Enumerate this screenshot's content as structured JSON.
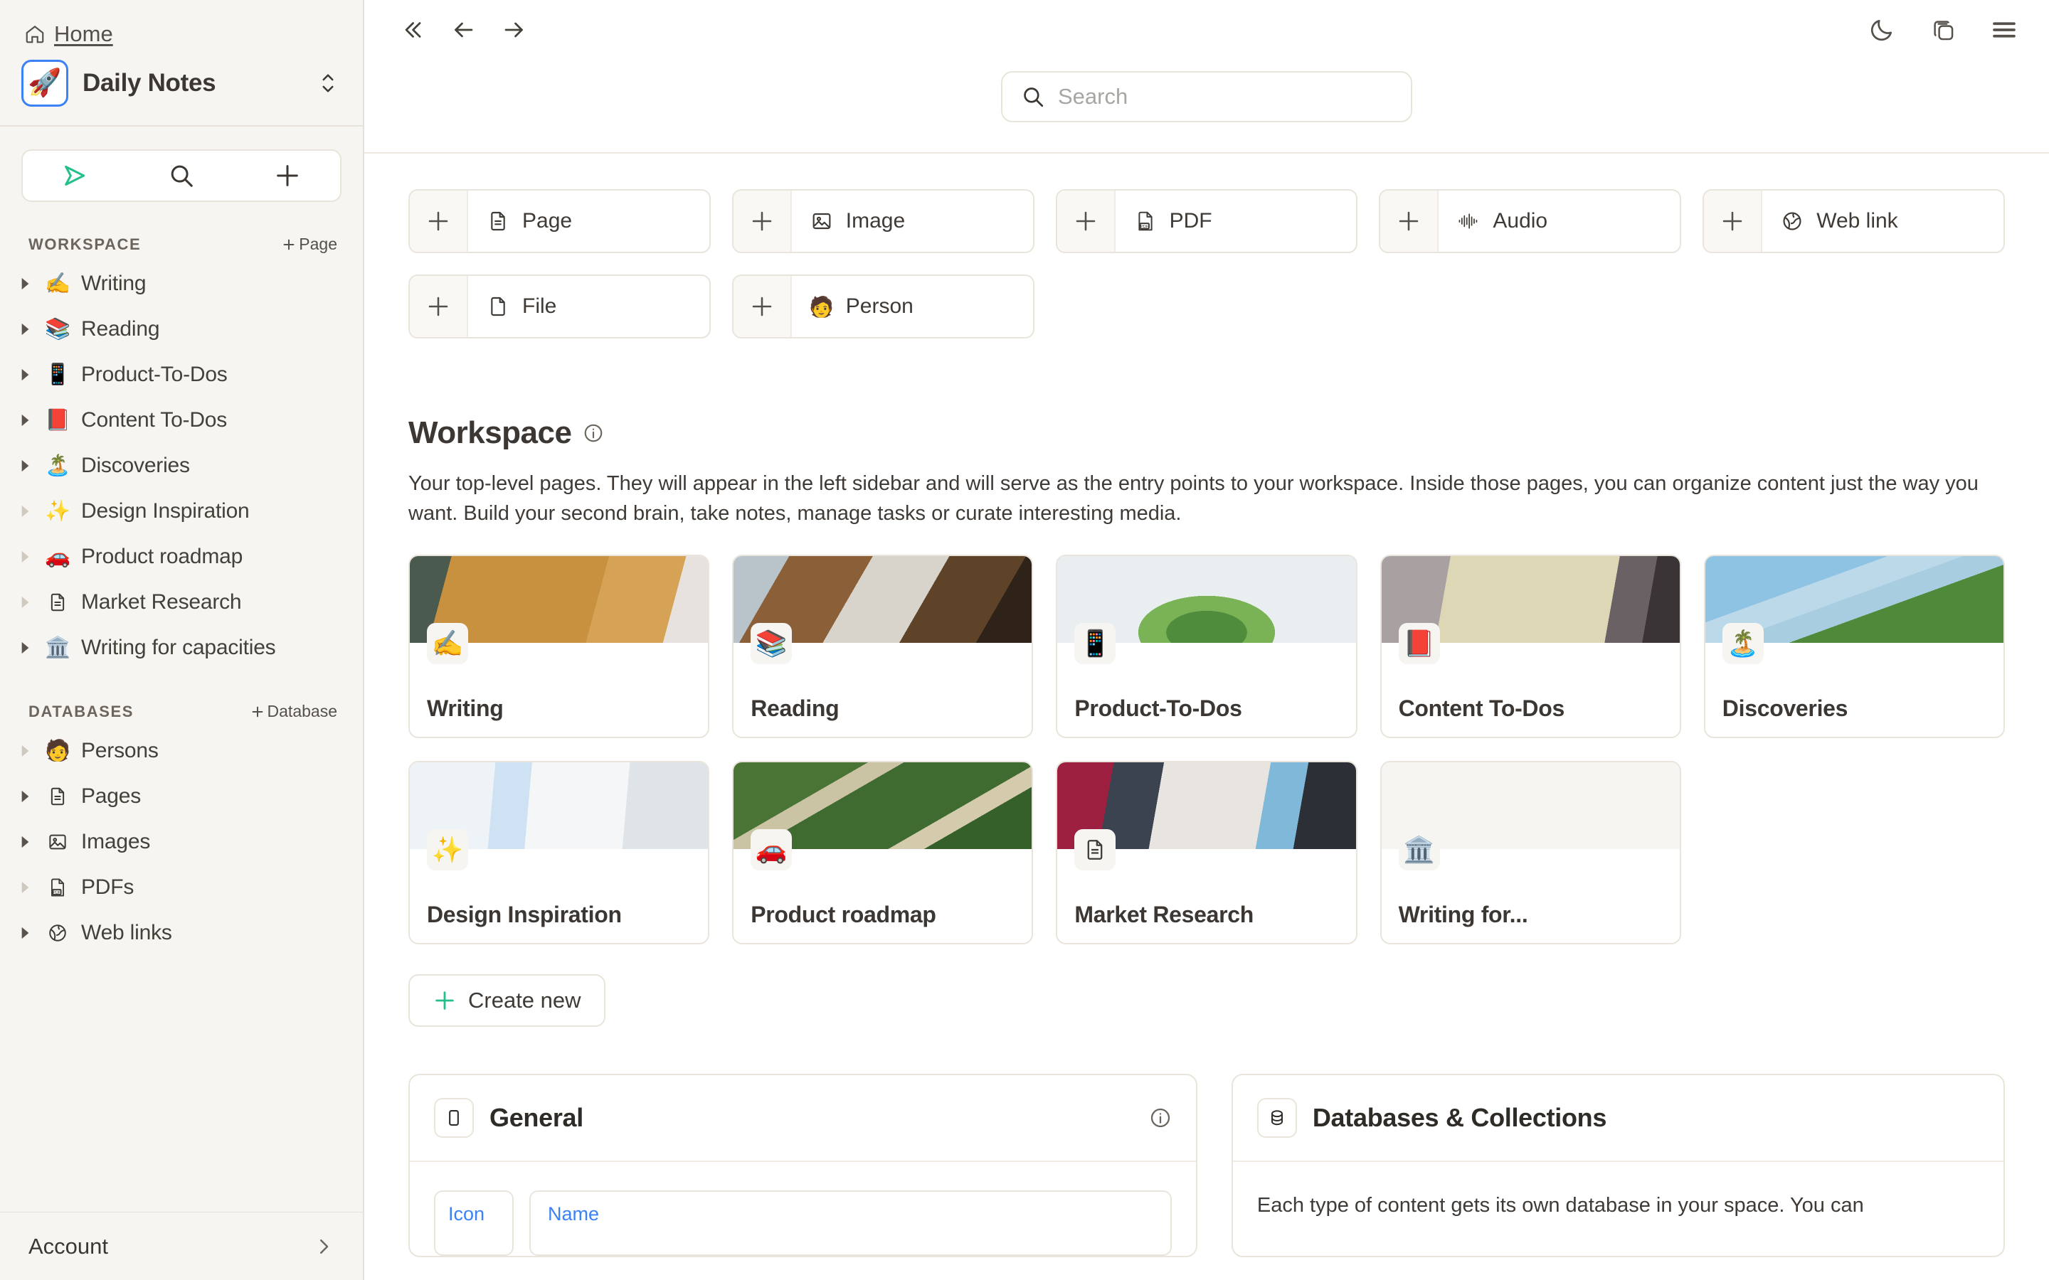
{
  "sidebar": {
    "home_label": "Home",
    "space_name": "Daily Notes",
    "space_emoji": "🚀",
    "action_bar": {
      "send_icon": "send-icon",
      "search_icon": "search-icon",
      "plus_icon": "plus-icon"
    },
    "workspace_section": {
      "label": "WORKSPACE",
      "add_label": "Page",
      "items": [
        {
          "emoji": "✍️",
          "label": "Writing",
          "caret": "dark"
        },
        {
          "emoji": "📚",
          "label": "Reading",
          "caret": "dark"
        },
        {
          "emoji": "📱",
          "label": "Product-To-Dos",
          "caret": "dark"
        },
        {
          "emoji": "📕",
          "label": "Content To-Dos",
          "caret": "dark"
        },
        {
          "emoji": "🏝️",
          "label": "Discoveries",
          "caret": "dark"
        },
        {
          "emoji": "✨",
          "label": "Design Inspiration",
          "caret": "light"
        },
        {
          "emoji": "🚗",
          "label": "Product roadmap",
          "caret": "light"
        },
        {
          "emoji": "doc-icon",
          "label": "Market Research",
          "caret": "light"
        },
        {
          "emoji": "🏛️",
          "label": "Writing for capacities",
          "caret": "dark"
        }
      ]
    },
    "databases_section": {
      "label": "DATABASES",
      "add_label": "Database",
      "items": [
        {
          "emoji": "🧑",
          "label": "Persons",
          "caret": "light"
        },
        {
          "emoji": "doc-icon",
          "label": "Pages",
          "caret": "dark"
        },
        {
          "emoji": "image-icon",
          "label": "Images",
          "caret": "dark"
        },
        {
          "emoji": "pdf-icon",
          "label": "PDFs",
          "caret": "light"
        },
        {
          "emoji": "globe-icon",
          "label": "Web links",
          "caret": "dark"
        }
      ]
    },
    "account_label": "Account"
  },
  "topbar": {
    "collapse_icon": "collapse-sidebar-icon",
    "back_icon": "arrow-left-icon",
    "forward_icon": "arrow-right-icon",
    "dark_mode_icon": "moon-icon",
    "layers_icon": "layers-icon",
    "menu_icon": "hamburger-menu-icon"
  },
  "search": {
    "placeholder": "Search",
    "value": "",
    "icon": "search-icon"
  },
  "quick_add": {
    "items": [
      {
        "label": "Page",
        "icon": "page-icon"
      },
      {
        "label": "Image",
        "icon": "image-icon"
      },
      {
        "label": "PDF",
        "icon": "pdf-icon"
      },
      {
        "label": "Audio",
        "icon": "audio-waveform-icon"
      },
      {
        "label": "Web link",
        "icon": "globe-icon"
      },
      {
        "label": "File",
        "icon": "file-icon"
      },
      {
        "label": "Person",
        "icon": "🧑"
      }
    ]
  },
  "workspace": {
    "title": "Workspace",
    "info_icon": "info-icon",
    "description": "Your top-level pages. They will appear in the left sidebar and will serve as the entry points to your workspace. Inside those pages, you can organize content just the way you want. Build your second brain, take notes, manage tasks or curate interesting media.",
    "cards": [
      {
        "name": "Writing",
        "emoji": "✍️",
        "thumb": "person-in-tan-sweater-writing"
      },
      {
        "name": "Reading",
        "emoji": "📚",
        "thumb": "hands-holding-open-book-on-wood-desk"
      },
      {
        "name": "Product-To-Dos",
        "emoji": "📱",
        "thumb": "green-succulent-plant-on-white"
      },
      {
        "name": "Content To-Dos",
        "emoji": "📕",
        "thumb": "sticky-notes-on-wall"
      },
      {
        "name": "Discoveries",
        "emoji": "🏝️",
        "thumb": "tree-against-blue-sky"
      },
      {
        "name": "Design Inspiration",
        "emoji": "✨",
        "thumb": "ux-design-diagram-sketch"
      },
      {
        "name": "Product roadmap",
        "emoji": "🚗",
        "thumb": "winding-road-through-forest-aerial"
      },
      {
        "name": "Market Research",
        "emoji": "doc-icon",
        "thumb": "team-working-on-blueprints"
      },
      {
        "name": "Writing for...",
        "emoji": "🏛️",
        "thumb": "empty"
      }
    ],
    "create_label": "Create new",
    "create_icon": "plus-icon"
  },
  "panels": [
    {
      "title": "General",
      "icon": "card-outline-icon",
      "info_icon": "info-icon",
      "fields": [
        {
          "label": "Icon"
        },
        {
          "label": "Name"
        }
      ]
    },
    {
      "title": "Databases & Collections",
      "icon": "database-stack-icon",
      "text": "Each type of content gets its own database in your space. You can"
    }
  ],
  "colors": {
    "accent_green": "#23c08a",
    "link_blue": "#3b82f6",
    "sidebar_bg": "#f7f5f1",
    "text": "#3c3733"
  }
}
